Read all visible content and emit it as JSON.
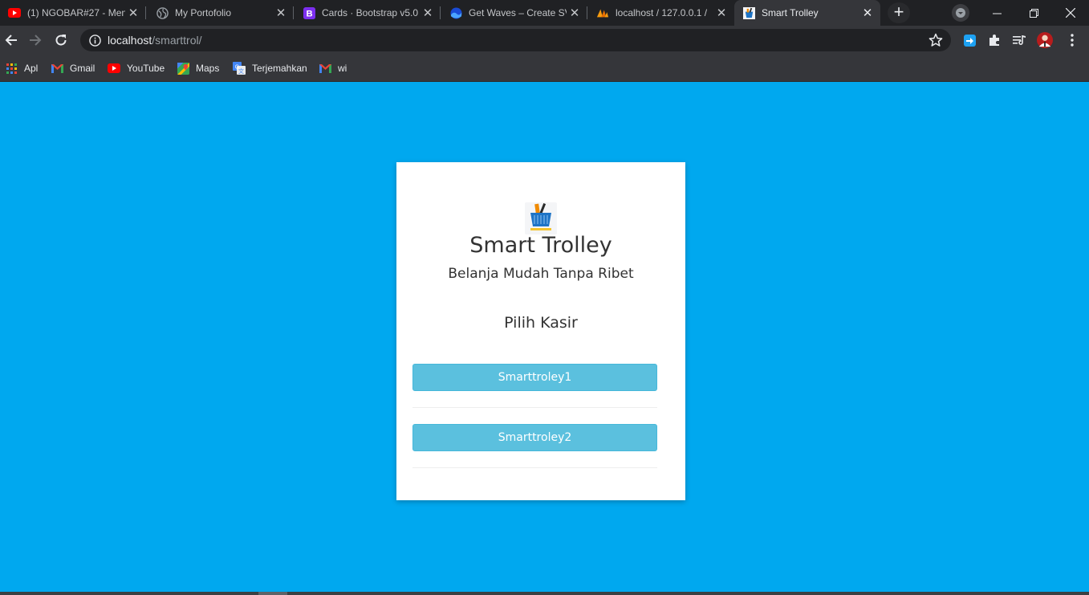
{
  "browser": {
    "tabs": [
      {
        "title": "(1) NGOBAR#27 - Men",
        "icon": "youtube-icon",
        "active": false
      },
      {
        "title": "My Portofolio",
        "icon": "globe-icon",
        "active": false
      },
      {
        "title": "Cards · Bootstrap v5.0",
        "icon": "bootstrap-icon",
        "active": false
      },
      {
        "title": "Get Waves – Create SV",
        "icon": "waves-icon",
        "active": false
      },
      {
        "title": "localhost / 127.0.0.1 / ",
        "icon": "phpmyadmin-icon",
        "active": false
      },
      {
        "title": "Smart Trolley",
        "icon": "smart-trolley-favicon",
        "active": true
      }
    ],
    "address": {
      "host": "localhost",
      "path": "/smarttrol/"
    },
    "bookmarks": [
      {
        "label": "Apl",
        "icon": "apps-grid-icon"
      },
      {
        "label": "Gmail",
        "icon": "gmail-icon"
      },
      {
        "label": "YouTube",
        "icon": "youtube-icon"
      },
      {
        "label": "Maps",
        "icon": "maps-icon"
      },
      {
        "label": "Terjemahkan",
        "icon": "translate-icon"
      },
      {
        "label": "wi",
        "icon": "gmail-icon"
      }
    ]
  },
  "page": {
    "background": "#00a8ef",
    "title": "Smart Trolley",
    "subtitle": "Belanja Mudah Tanpa Ribet",
    "heading": "Pilih Kasir",
    "buttons": [
      {
        "label": "Smarttroley1"
      },
      {
        "label": "Smarttroley2"
      }
    ],
    "button_color": "#5bc0de"
  }
}
